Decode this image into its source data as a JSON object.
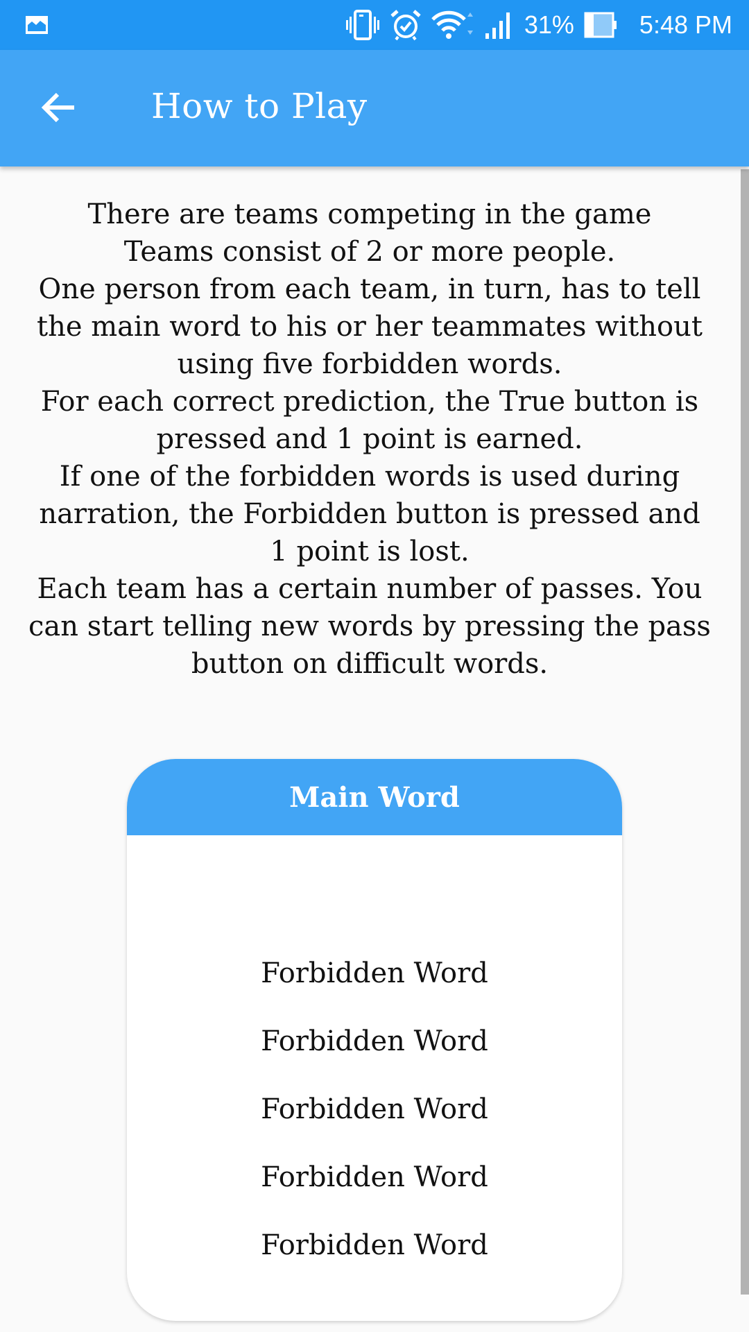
{
  "status_bar": {
    "notification_icon": "image-icon",
    "icons": [
      "vibrate-icon",
      "alarm-icon",
      "wifi-icon",
      "signal-icon",
      "battery-icon"
    ],
    "battery_percent": "31%",
    "time": "5:48 PM"
  },
  "app_bar": {
    "back_icon": "arrow-left-icon",
    "title": "How to Play"
  },
  "instructions": {
    "lines": [
      "There are teams competing in the game",
      "Teams consist of 2 or more people.",
      "One person from each team, in turn, has to tell the main word to his or her teammates without using five forbidden words.",
      "For each correct prediction, the True button is pressed and 1 point is earned.",
      "If one of the forbidden words is used during narration, the Forbidden button is pressed and 1 point is lost.",
      "Each team has a certain number of passes. You can start telling new words by pressing the pass button on difficult words."
    ]
  },
  "card": {
    "header": "Main Word",
    "forbidden_words": [
      "Forbidden Word",
      "Forbidden Word",
      "Forbidden Word",
      "Forbidden Word",
      "Forbidden Word"
    ]
  },
  "colors": {
    "status_bar": "#2196f3",
    "primary": "#42a5f5",
    "background": "#fafafa",
    "text": "#111111",
    "scrollbar": "#b3b3b3"
  }
}
